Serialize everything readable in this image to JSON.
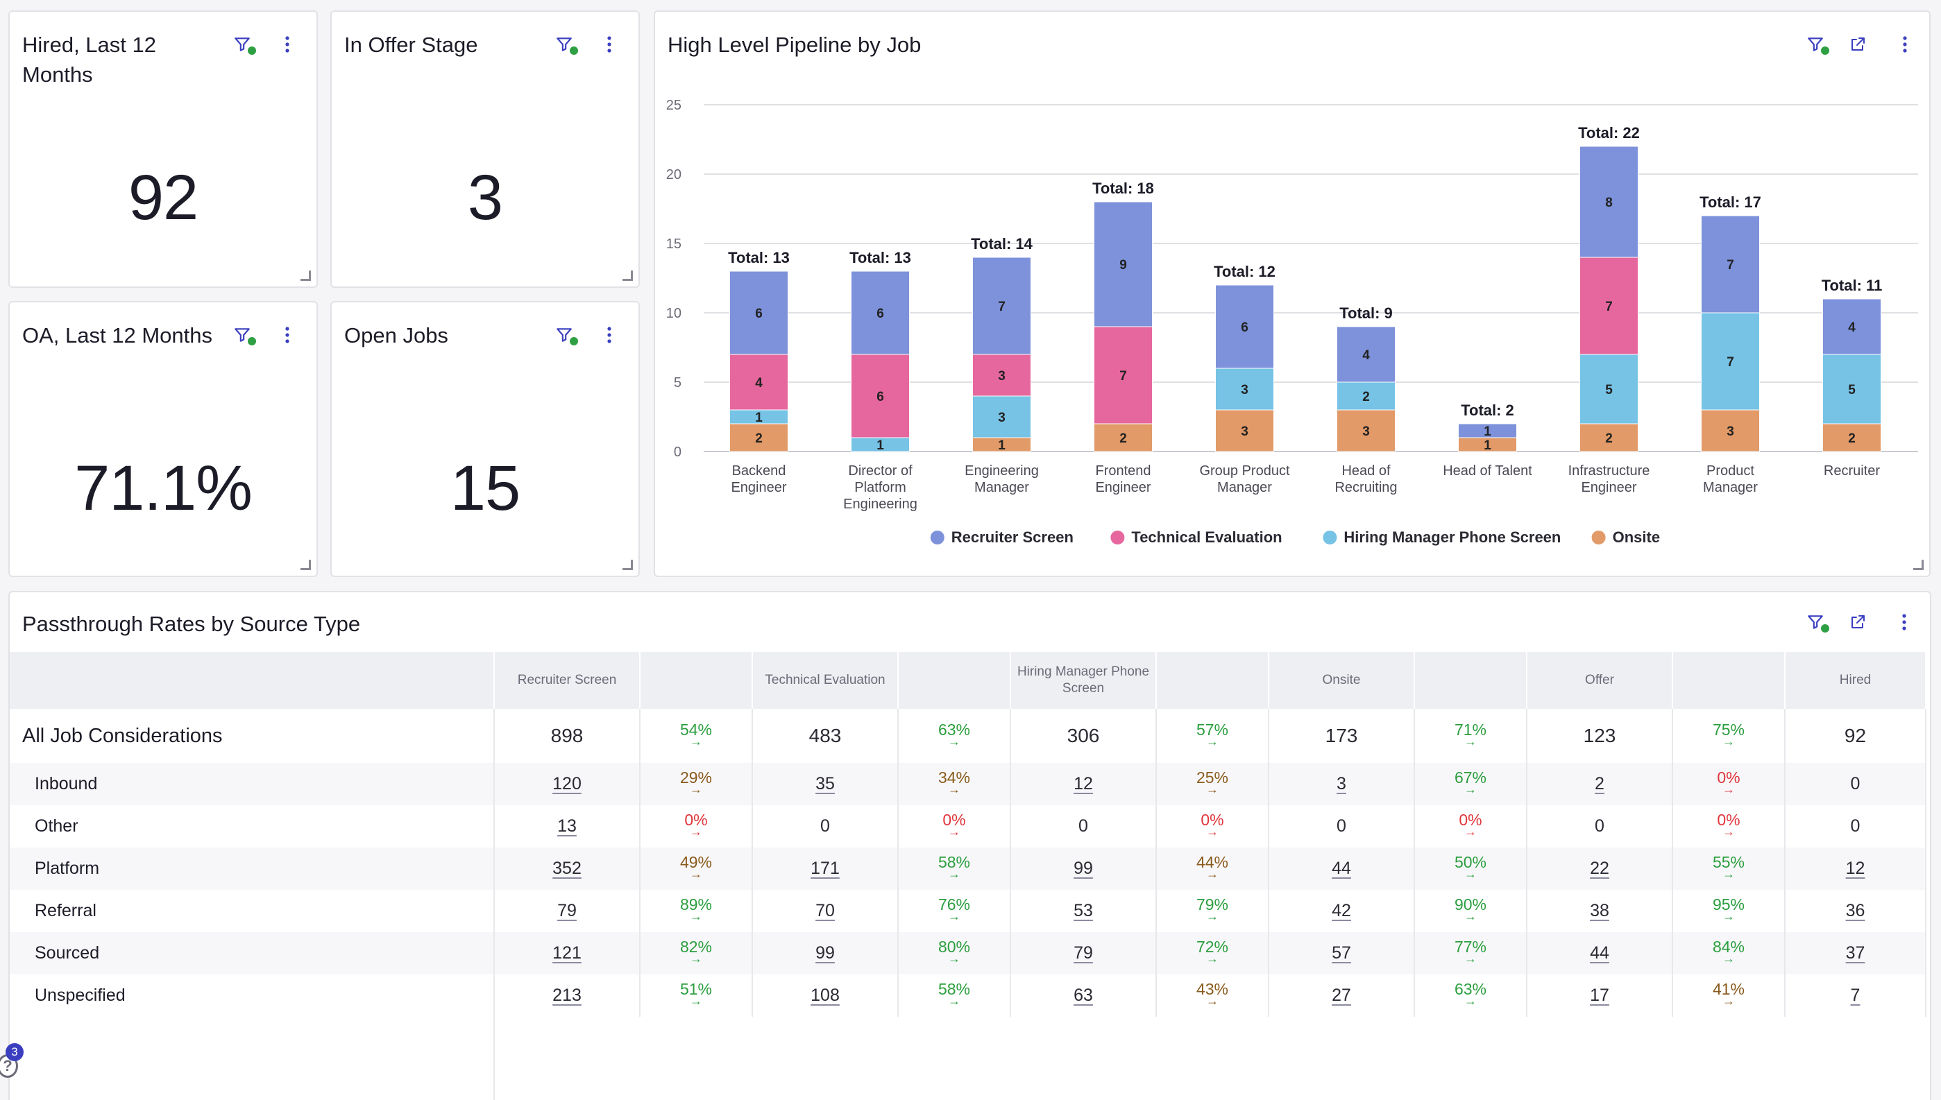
{
  "kpis": {
    "hired": {
      "title": "Hired, Last 12 Months",
      "value": "92"
    },
    "offer": {
      "title": "In Offer Stage",
      "value": "3"
    },
    "oa": {
      "title": "OA, Last 12 Months",
      "value": "71.1%"
    },
    "open_jobs": {
      "title": "Open Jobs",
      "value": "15"
    }
  },
  "pipeline": {
    "title": "High Level Pipeline by Job"
  },
  "chart_data": {
    "type": "bar",
    "stacked": true,
    "title": "High Level Pipeline by Job",
    "xlabel": "",
    "ylabel": "",
    "ylim": [
      0,
      25
    ],
    "yticks": [
      0,
      5,
      10,
      15,
      20,
      25
    ],
    "grid": true,
    "legend_position": "bottom",
    "categories": [
      [
        "Backend",
        "Engineer"
      ],
      [
        "Director of",
        "Platform",
        "Engineering"
      ],
      [
        "Engineering",
        "Manager"
      ],
      [
        "Frontend",
        "Engineer"
      ],
      [
        "Group Product",
        "Manager"
      ],
      [
        "Head of",
        "Recruiting"
      ],
      [
        "Head of Talent"
      ],
      [
        "Infrastructure",
        "Engineer"
      ],
      [
        "Product",
        "Manager"
      ],
      [
        "Recruiter"
      ]
    ],
    "totals": [
      "Total: 13",
      "Total: 13",
      "Total: 14",
      "Total: 18",
      "Total: 12",
      "Total: 9",
      "Total: 2",
      "Total: 22",
      "Total: 17",
      "Total: 11"
    ],
    "series": [
      {
        "name": "Onsite",
        "color": "#e29a68",
        "values": [
          2,
          0,
          1,
          2,
          3,
          3,
          1,
          2,
          3,
          2
        ]
      },
      {
        "name": "Hiring Manager Phone Screen",
        "color": "#76c3e6",
        "values": [
          1,
          1,
          3,
          0,
          3,
          2,
          0,
          5,
          7,
          5
        ]
      },
      {
        "name": "Technical Evaluation",
        "color": "#e6679d",
        "values": [
          4,
          6,
          3,
          7,
          0,
          0,
          0,
          7,
          0,
          0
        ]
      },
      {
        "name": "Recruiter Screen",
        "color": "#7d92da",
        "values": [
          6,
          6,
          7,
          9,
          6,
          4,
          1,
          8,
          7,
          4
        ]
      }
    ],
    "legend_order": [
      "Recruiter Screen",
      "Technical Evaluation",
      "Hiring Manager Phone Screen",
      "Onsite"
    ]
  },
  "passthrough": {
    "title": "Passthrough Rates by Source Type",
    "columns": [
      "",
      "Recruiter Screen",
      "",
      "Technical Evaluation",
      "",
      "Hiring Manager Phone Screen",
      "",
      "Onsite",
      "",
      "Offer",
      "",
      "Hired"
    ],
    "rows": [
      {
        "label": "All Job Considerations",
        "cells": [
          "898",
          "54%",
          "483",
          "63%",
          "306",
          "57%",
          "173",
          "71%",
          "123",
          "75%",
          "92"
        ],
        "pct_colors": [
          "green",
          "green",
          "green",
          "green",
          "green"
        ]
      },
      {
        "label": "Inbound",
        "cells": [
          "120",
          "29%",
          "35",
          "34%",
          "12",
          "25%",
          "3",
          "67%",
          "2",
          "0%",
          "0"
        ],
        "pct_colors": [
          "brown",
          "brown",
          "brown",
          "green",
          "red"
        ]
      },
      {
        "label": "Other",
        "cells": [
          "13",
          "0%",
          "0",
          "0%",
          "0",
          "0%",
          "0",
          "0%",
          "0",
          "0%",
          "0"
        ],
        "pct_colors": [
          "red",
          "red",
          "red",
          "red",
          "red"
        ]
      },
      {
        "label": "Platform",
        "cells": [
          "352",
          "49%",
          "171",
          "58%",
          "99",
          "44%",
          "44",
          "50%",
          "22",
          "55%",
          "12"
        ],
        "pct_colors": [
          "brown",
          "green",
          "brown",
          "green",
          "green"
        ]
      },
      {
        "label": "Referral",
        "cells": [
          "79",
          "89%",
          "70",
          "76%",
          "53",
          "79%",
          "42",
          "90%",
          "38",
          "95%",
          "36"
        ],
        "pct_colors": [
          "green",
          "green",
          "green",
          "green",
          "green"
        ]
      },
      {
        "label": "Sourced",
        "cells": [
          "121",
          "82%",
          "99",
          "80%",
          "79",
          "72%",
          "57",
          "77%",
          "44",
          "84%",
          "37"
        ],
        "pct_colors": [
          "green",
          "green",
          "green",
          "green",
          "green"
        ]
      },
      {
        "label": "Unspecified",
        "cells": [
          "213",
          "51%",
          "108",
          "58%",
          "63",
          "43%",
          "27",
          "63%",
          "17",
          "41%",
          "7"
        ],
        "pct_colors": [
          "green",
          "green",
          "brown",
          "green",
          "brown"
        ]
      }
    ],
    "arrow_glyph": "→"
  },
  "help": {
    "badge_count": "3",
    "glyph": "?"
  },
  "colors": {
    "accent": "#3b3fbf",
    "filter_dot": "#2ea043",
    "icon": "#3b3fbf"
  }
}
